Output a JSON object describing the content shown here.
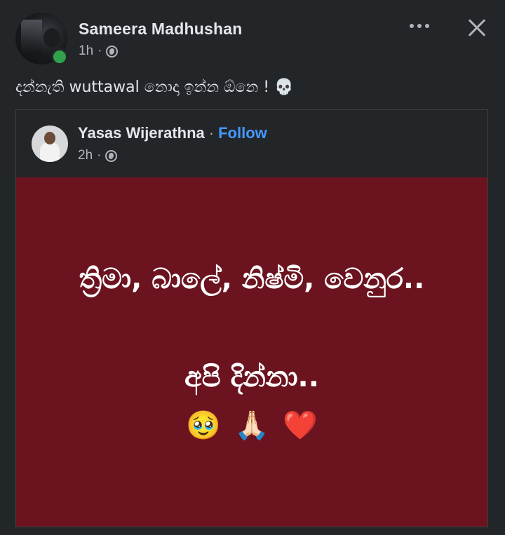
{
  "post": {
    "author": "Sameera Madhushan",
    "time": "1h",
    "dot": "·",
    "visibility_icon": "globe-icon",
    "caption": "දන්නැති wuttawal නොදා ඉන්න ඕනෙ !",
    "caption_emoji": "💀",
    "online": true
  },
  "shared": {
    "author": "Yasas Wijerathna",
    "separator": "·",
    "follow_label": "Follow",
    "time": "2h",
    "dot": "·",
    "visibility_icon": "globe-icon",
    "image": {
      "background": "#6b1420",
      "line1": "ත්‍රිමා, බාලේ, නිෂ්මි, වෙනුර..",
      "line2": "අපි දින්නා..",
      "emojis": [
        "🥹",
        "🙏🏻",
        "❤️"
      ]
    }
  },
  "colors": {
    "background": "#232629",
    "link": "#4599ff",
    "online": "#31a24c"
  }
}
